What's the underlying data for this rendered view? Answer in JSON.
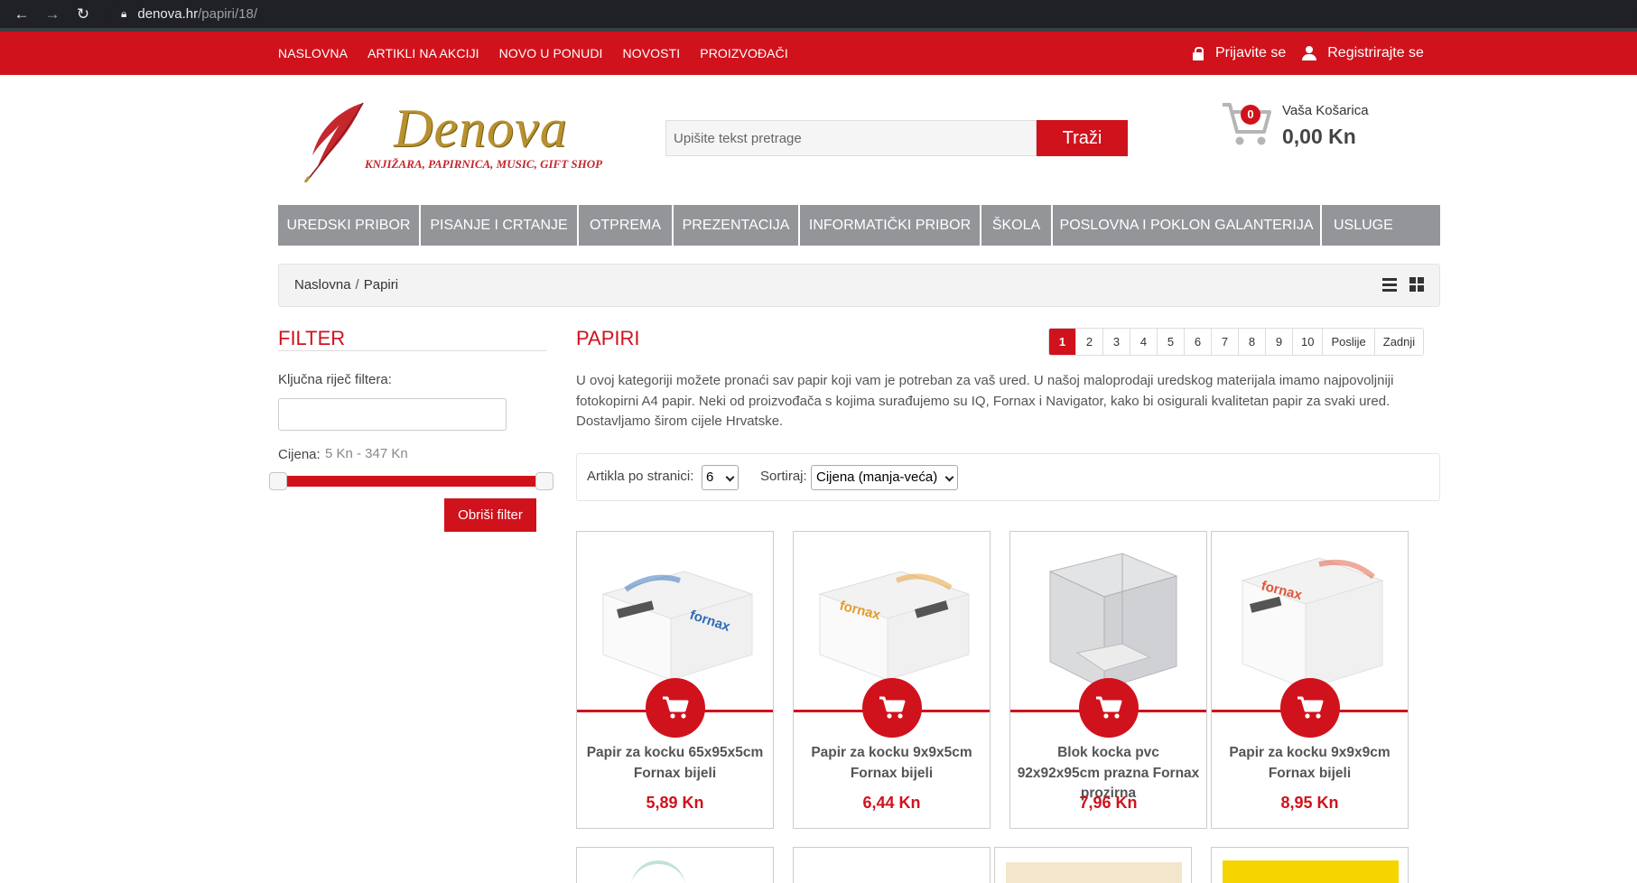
{
  "browser": {
    "url_host": "denova.hr",
    "url_path": "/papiri/18/"
  },
  "topbar": {
    "nav": [
      "NASLOVNA",
      "ARTIKLI NA AKCIJI",
      "NOVO U PONUDI",
      "NOVOSTI",
      "PROIZVOĐAČI"
    ],
    "login": "Prijavite se",
    "register": "Registrirajte se"
  },
  "logo": {
    "word": "Denova",
    "tagline": "KNJIŽARA, PAPIRNICA, MUSIC, GIFT SHOP"
  },
  "search": {
    "placeholder": "Upišite tekst pretrage",
    "button": "Traži"
  },
  "cart": {
    "count": "0",
    "label": "Vaša Košarica",
    "total": "0,00 Kn"
  },
  "categories": [
    "UREDSKI PRIBOR",
    "PISANJE I CRTANJE",
    "OTPREMA",
    "PREZENTACIJA",
    "INFORMATIČKI PRIBOR",
    "ŠKOLA",
    "POSLOVNA I POKLON GALANTERIJA",
    "USLUGE"
  ],
  "breadcrumb": {
    "home": "Naslovna",
    "sep": "/",
    "current": "Papiri"
  },
  "filter": {
    "title": "FILTER",
    "keyword_label": "Ključna riječ filtera:",
    "keyword_value": "",
    "price_label": "Cijena:",
    "price_range": "5 Kn - 347 Kn",
    "clear_button": "Obriši filter"
  },
  "main": {
    "title": "PAPIRI",
    "description": "U ovoj kategoriji možete pronaći sav papir koji vam je potreban za vaš ured. U našoj maloprodaji uredskog materijala imamo najpovoljniji fotokopirni A4 papir. Neki od proizvođača s kojima surađujemo su IQ, Fornax i Navigator, kako bi osigurali kvalitetan papir za svaki ured. Dostavljamo širom cijele Hrvatske.",
    "pagination": [
      "1",
      "2",
      "3",
      "4",
      "5",
      "6",
      "7",
      "8",
      "9",
      "10",
      "Poslije",
      "Zadnji"
    ],
    "active_page": "1",
    "per_page_label": "Artikla po stranici:",
    "per_page_value": "6",
    "sort_label": "Sortiraj:",
    "sort_value": "Cijena (manja-veća)"
  },
  "products": [
    {
      "name": "Papir za kocku 65x95x5cm Fornax bijeli",
      "price": "5,89 Kn",
      "accent": "#2d6cb5"
    },
    {
      "name": "Papir za kocku 9x9x5cm Fornax bijeli",
      "price": "6,44 Kn",
      "accent": "#e59a2b"
    },
    {
      "name": "Blok kocka pvc 92x92x95cm prazna Fornax prozirna",
      "price": "7,96 Kn",
      "accent": "#9a9a9a"
    },
    {
      "name": "Papir za kocku 9x9x9cm Fornax bijeli",
      "price": "8,95 Kn",
      "accent": "#e0553a"
    }
  ],
  "colors": {
    "brand_red": "#d0121c",
    "nav_gray": "#939599"
  }
}
